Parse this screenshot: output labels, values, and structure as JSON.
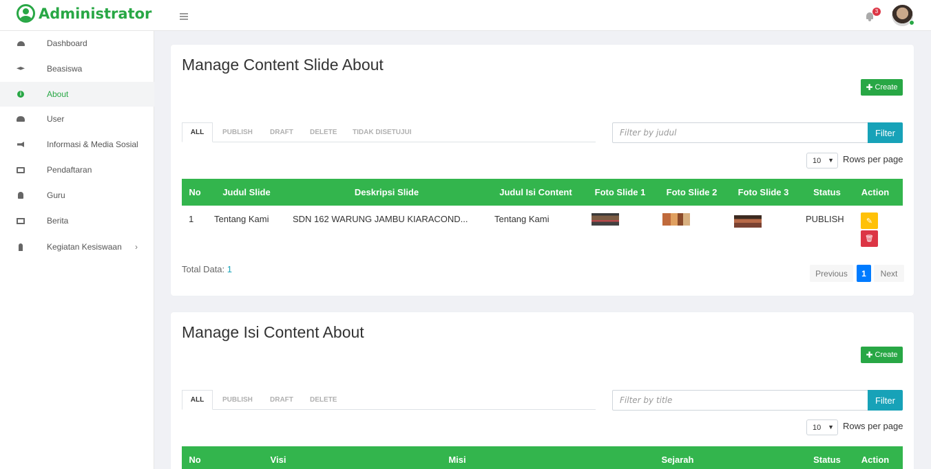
{
  "brand": {
    "title": "Administrator"
  },
  "header": {
    "notification_count": "3"
  },
  "sidebar": {
    "items": [
      {
        "label": "Dashboard",
        "icon": "tachometer-icon"
      },
      {
        "label": "Beasiswa",
        "icon": "graduation-cap-icon"
      },
      {
        "label": "About",
        "icon": "info-circle-icon",
        "active": true
      },
      {
        "label": "User",
        "icon": "users-icon"
      },
      {
        "label": "Informasi & Media Sosial",
        "icon": "bullhorn-icon"
      },
      {
        "label": "Pendaftaran",
        "icon": "id-card-icon"
      },
      {
        "label": "Guru",
        "icon": "user-icon"
      },
      {
        "label": "Berita",
        "icon": "newspaper-icon"
      },
      {
        "label": "Kegiatan Kesiswaan",
        "icon": "child-icon",
        "has_children": true
      }
    ],
    "chevron": "›"
  },
  "slide_section": {
    "title": "Manage Content Slide About",
    "create_label": "Create",
    "tabs": [
      "ALL",
      "PUBLISH",
      "DRAFT",
      "DELETE",
      "TIDAK DISETUJUI"
    ],
    "filter_placeholder": "Filter by judul",
    "filter_label": "Filter",
    "rows_per_page_value": "10",
    "rows_per_page_label": "Rows per page",
    "columns": [
      "No",
      "Judul Slide",
      "Deskripsi Slide",
      "Judul Isi Content",
      "Foto Slide 1",
      "Foto Slide 2",
      "Foto Slide 3",
      "Status",
      "Action"
    ],
    "rows": [
      {
        "no": "1",
        "judul_slide": "Tentang Kami",
        "deskripsi": "SDN 162 WARUNG JAMBU KIARACOND...",
        "judul_isi": "Tentang Kami",
        "status": "PUBLISH"
      }
    ],
    "total_label": "Total Data:",
    "total_value": "1",
    "pagination": {
      "previous": "Previous",
      "current": "1",
      "next": "Next"
    }
  },
  "isi_section": {
    "title": "Manage Isi Content About",
    "create_label": "Create",
    "tabs": [
      "ALL",
      "PUBLISH",
      "DRAFT",
      "DELETE"
    ],
    "filter_placeholder": "Filter by title",
    "filter_label": "Filter",
    "rows_per_page_value": "10",
    "rows_per_page_label": "Rows per page",
    "columns": [
      "No",
      "Visi",
      "Misi",
      "Sejarah",
      "Status",
      "Action"
    ]
  },
  "colors": {
    "brand_green": "#28a745",
    "table_header": "#33b54d",
    "filter_button": "#17a2b8",
    "page_active": "#007bff",
    "edit": "#ffc107",
    "delete": "#dc3545"
  }
}
